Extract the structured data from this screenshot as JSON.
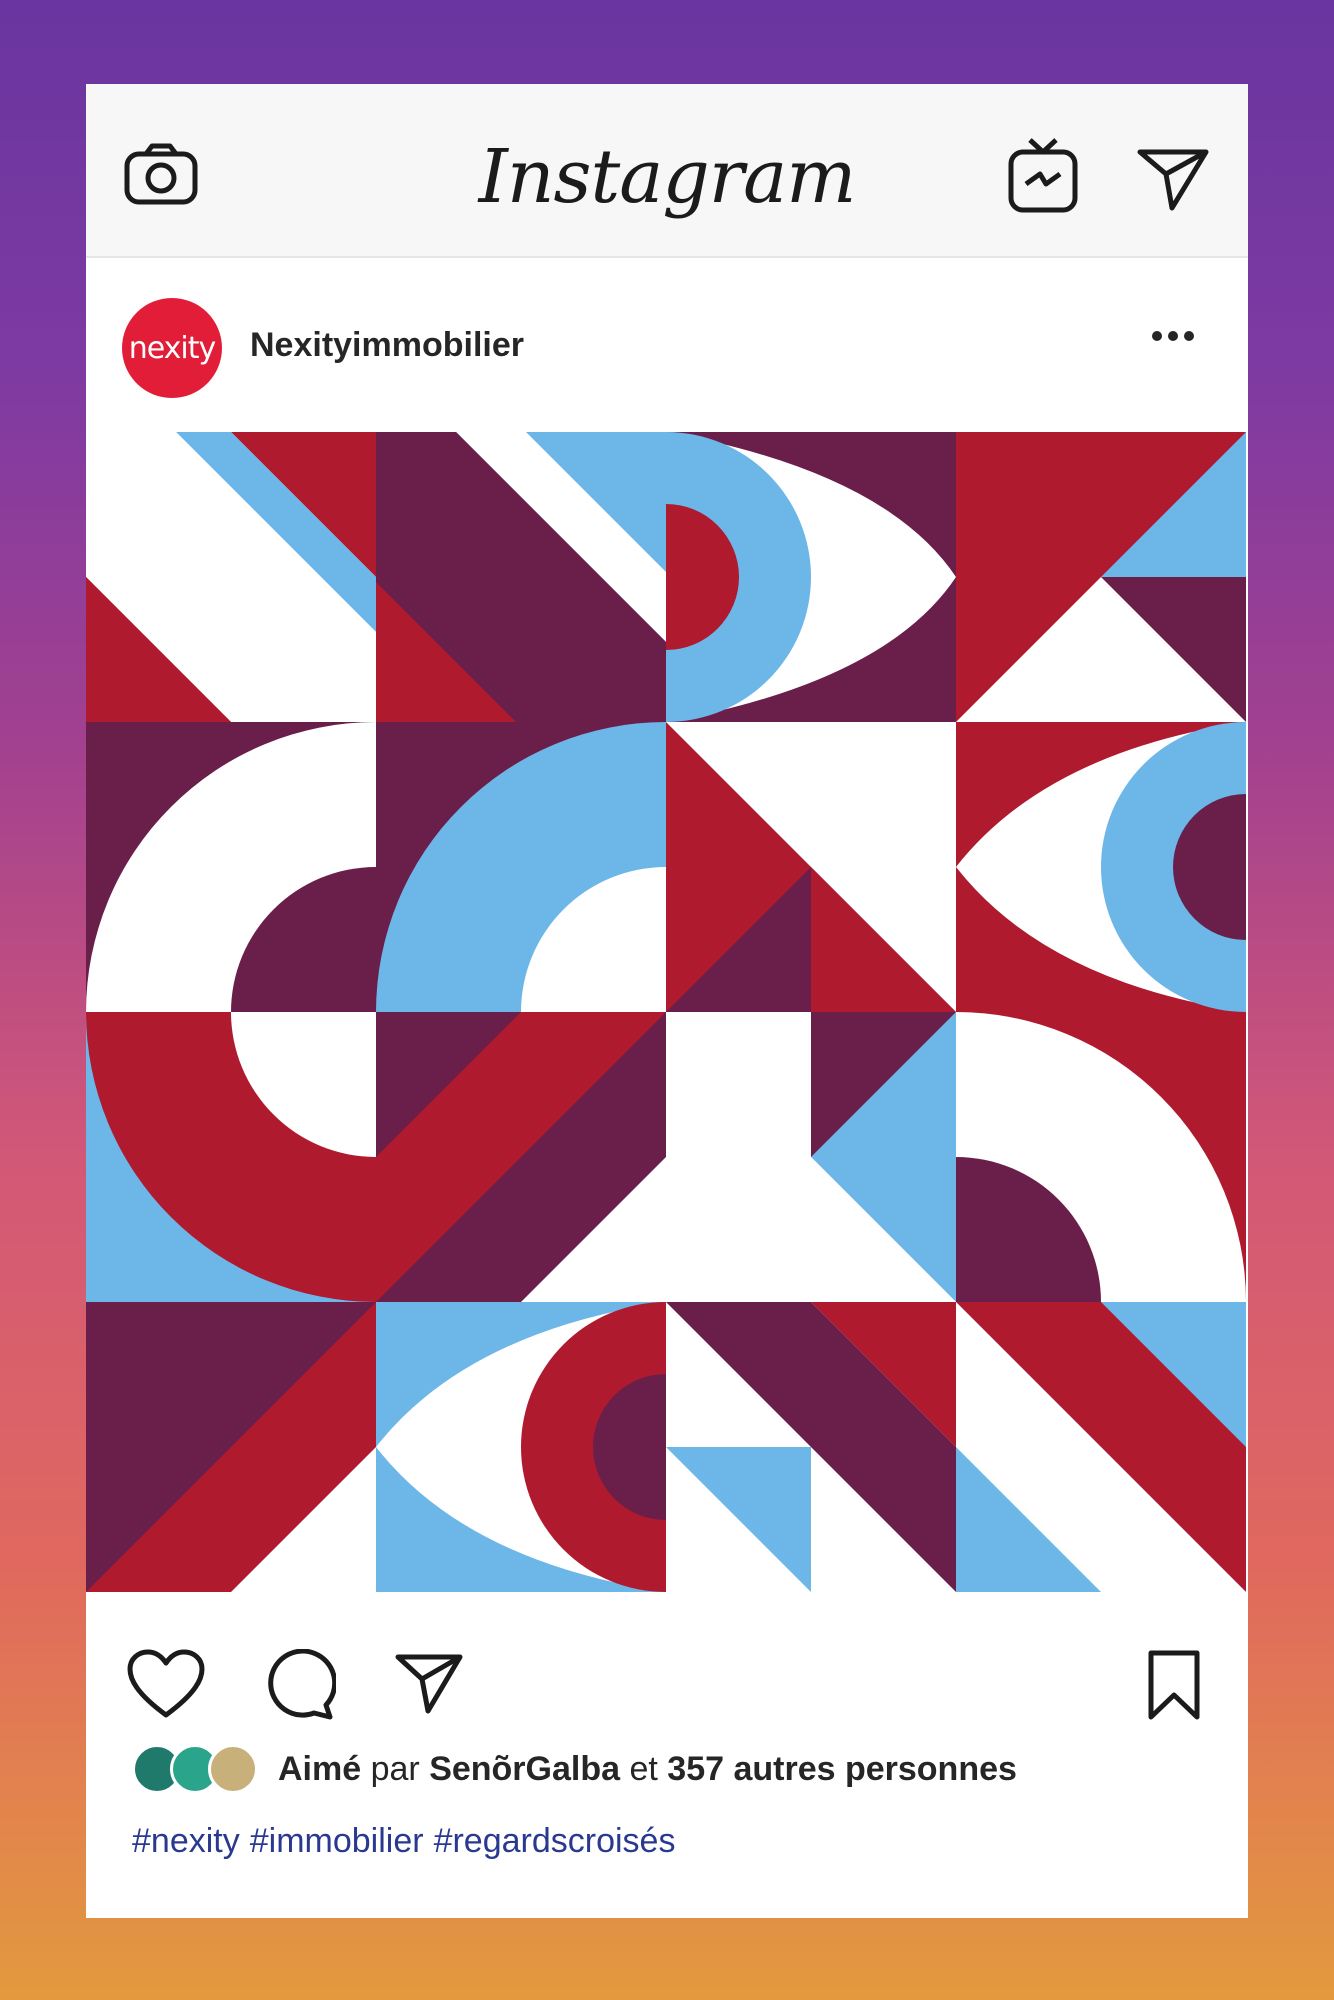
{
  "app": {
    "title": "Instagram"
  },
  "colors": {
    "accent_red": "#b01a2e",
    "plum": "#6a1f4a",
    "sky_blue": "#6db6e8",
    "brand_red": "#e11d37",
    "hashtag_blue": "#2a3990"
  },
  "icons": {
    "camera": "camera-icon",
    "igtv": "igtv-icon",
    "direct": "paper-plane-icon",
    "more": "more-options-icon",
    "like": "heart-icon",
    "comment": "comment-icon",
    "share": "paper-plane-icon",
    "save": "bookmark-icon"
  },
  "post": {
    "avatar_text": "nexity",
    "username": "Nexityimmobilier",
    "image_description_name": "geometric-artwork"
  },
  "likes": {
    "prefix": "Aimé",
    "par": "par",
    "user": "SenõrGalba",
    "et": "et",
    "count_text": "357 autres personnes",
    "avatar_colors": [
      "#1f7a6c",
      "#2aa58c",
      "#c8b07a"
    ]
  },
  "hashtags": [
    "#nexity",
    "#immobilier",
    "#regardscroisés"
  ]
}
